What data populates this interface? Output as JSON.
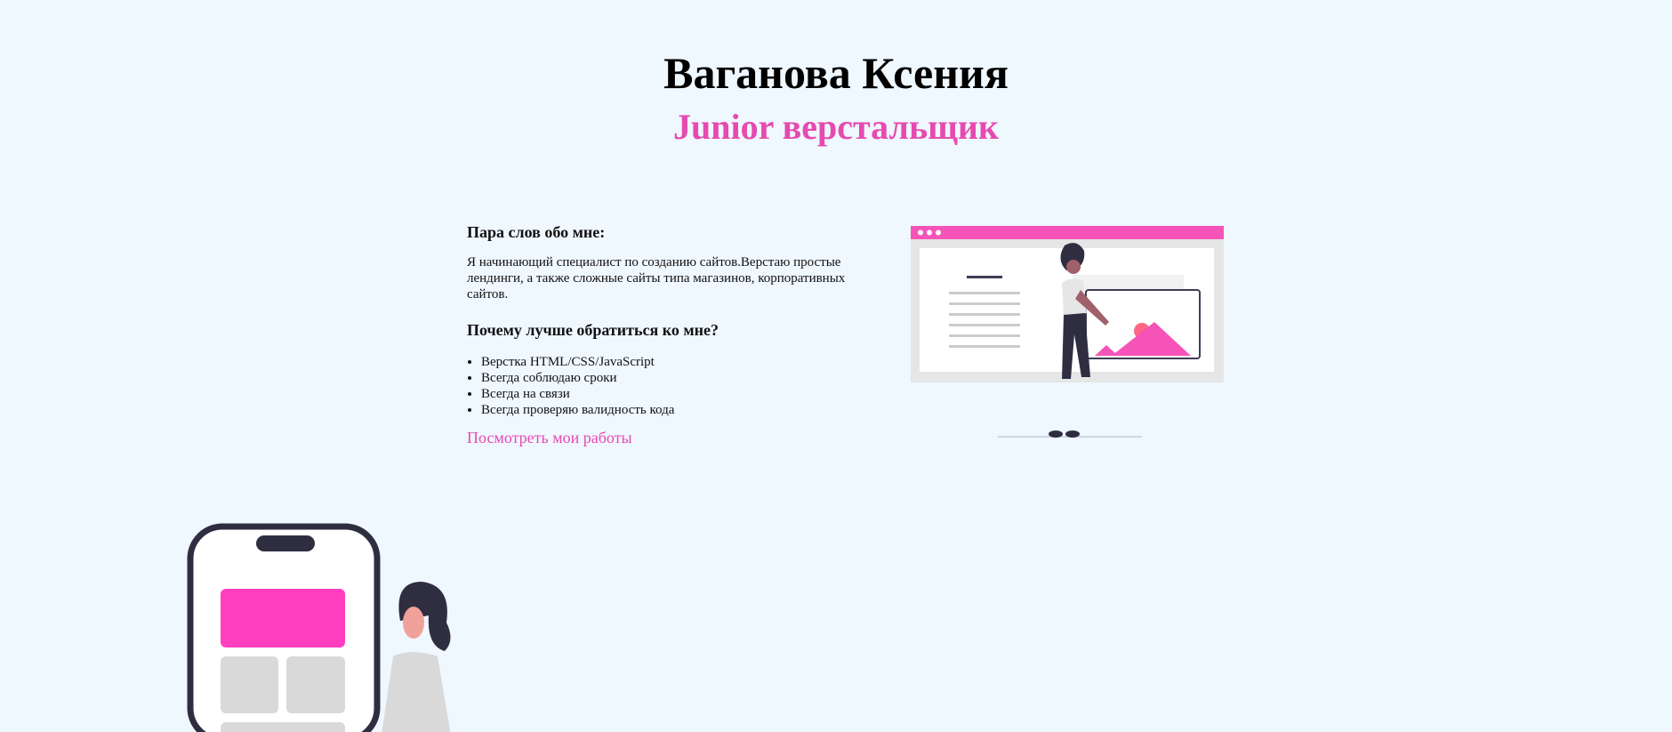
{
  "header": {
    "name": "Ваганова Ксения",
    "role": "Junior верстальщик"
  },
  "about": {
    "heading": "Пара слов обо мне:",
    "text": "Я начинающий специалист по созданию сайтов.Верстаю простые лендинги, а также сложные сайты типа магазинов, корпоративных сайтов.",
    "why_heading": "Почему лучше обратиться ко мне?",
    "reasons": [
      "Верстка HTML/CSS/JavaScript",
      "Всегда соблюдаю сроки",
      "Всегда на связи",
      "Всегда проверяю валидность кода"
    ],
    "works_link": "Посмотреть мои работы"
  },
  "colors": {
    "background": "#eff7ff",
    "accent": "#e64ab0",
    "text": "#111111"
  },
  "illustrations": {
    "web": "woman-presenting-website-illustration",
    "phone": "woman-with-phone-illustration"
  }
}
